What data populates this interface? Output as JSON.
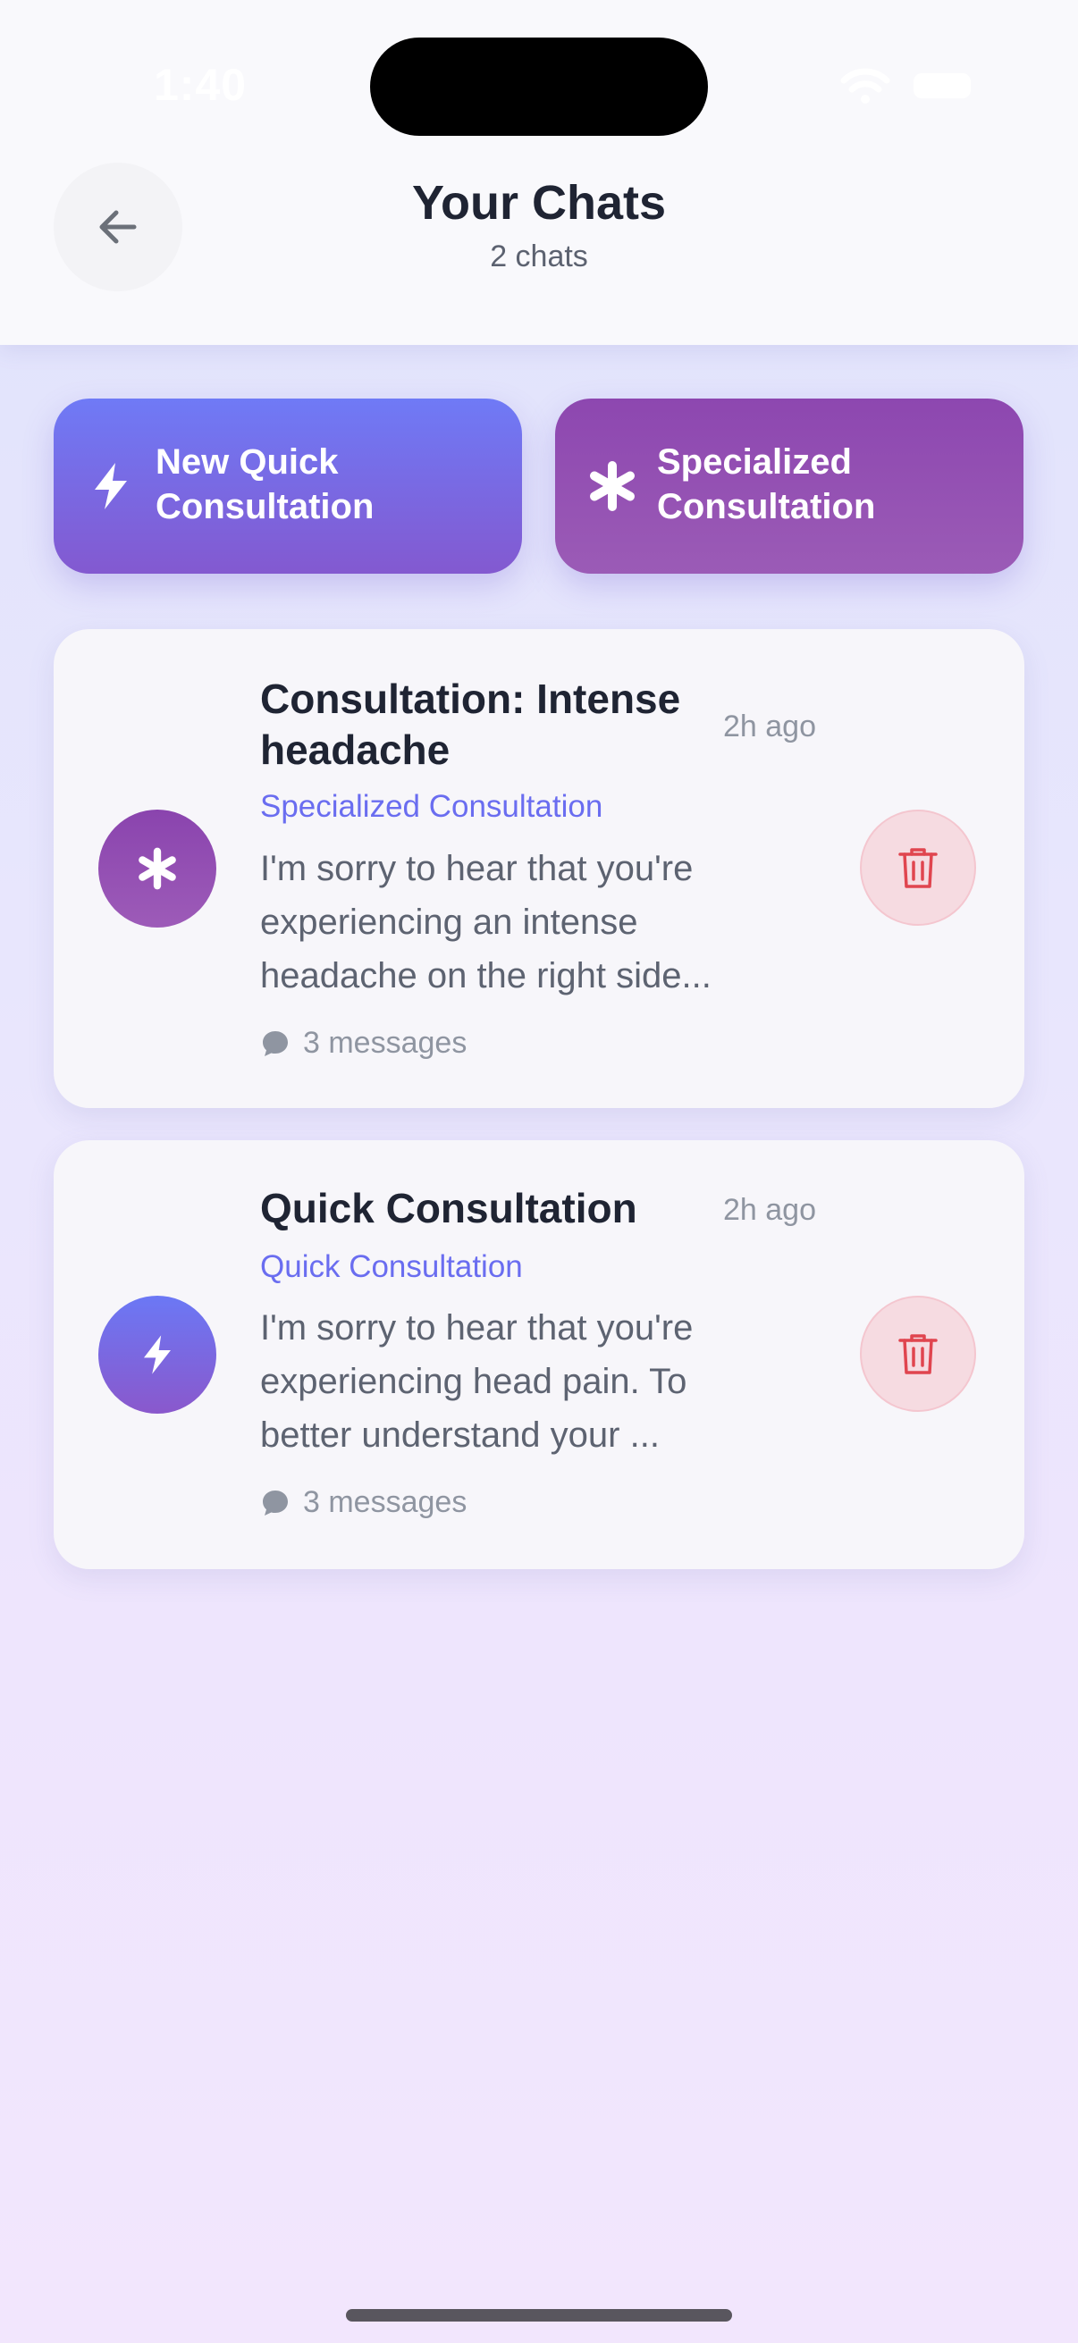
{
  "status_bar": {
    "time": "1:40"
  },
  "header": {
    "title": "Your Chats",
    "subtitle": "2 chats"
  },
  "actions": [
    {
      "label": "New Quick Consultation",
      "icon": "lightning-icon"
    },
    {
      "label": "Specialized Consultation",
      "icon": "asterisk-icon"
    }
  ],
  "chats": [
    {
      "title": "Consultation: Intense headache",
      "time": "2h ago",
      "type": "Specialized Consultation",
      "preview": "I'm sorry to hear that you're experiencing an intense headache on the right side...",
      "messages": "3 messages",
      "icon": "asterisk-icon"
    },
    {
      "title": "Quick Consultation",
      "time": "2h ago",
      "type": "Quick Consultation",
      "preview": "I'm sorry to hear that you're experiencing head pain. To better understand your ...",
      "messages": "3 messages",
      "icon": "lightning-icon"
    }
  ],
  "colors": {
    "accent": "#6a6df0",
    "specialized": "#8d47b0",
    "quick": "#6f7af6",
    "delete": "#e0454f"
  }
}
